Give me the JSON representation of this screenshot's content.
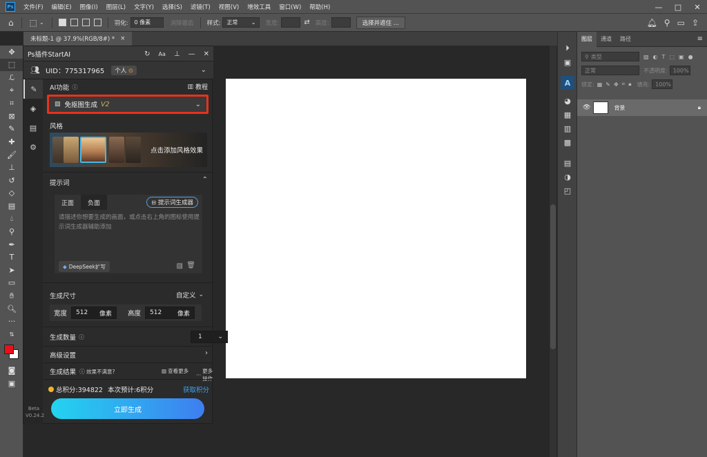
{
  "app": {
    "logo": "Ps"
  },
  "menubar": {
    "items": [
      "文件(F)",
      "编辑(E)",
      "图像(I)",
      "图层(L)",
      "文字(Y)",
      "选择(S)",
      "滤镜(T)",
      "视图(V)",
      "增效工具",
      "窗口(W)",
      "帮助(H)"
    ],
    "window_controls": [
      "—",
      "□",
      "✕"
    ]
  },
  "options_bar": {
    "feather_label": "羽化:",
    "feather_value": "0 像素",
    "antialias_label": "消除锯齿",
    "style_label": "样式:",
    "style_value": "正常",
    "width_label": "宽度:",
    "height_label": "高度:",
    "select_mask_button": "选择并遮住 ..."
  },
  "document": {
    "tab_title": "未标题-1 @ 37.9%(RGB/8#) *",
    "close": "×"
  },
  "plugin": {
    "title": "Ps插件StartAI",
    "uid": "UID：775317965",
    "account_type": "个人",
    "ai_function_label": "AI功能",
    "tutorial_label": "教程",
    "function_value": "免抠图生成",
    "function_version": "V2",
    "style_label": "风格",
    "style_add_label": "点击添加风格效果",
    "prompt_label": "提示词",
    "tab_positive": "正面",
    "tab_negative": "负面",
    "prompt_generator": "提示词生成器",
    "prompt_placeholder": "请描述你想要生成的画面，或点击右上角的图标使用提示词生成器辅助添加",
    "deepseek_label": "DeepSeek扩写",
    "size_label": "生成尺寸",
    "size_mode": "自定义",
    "width_label": "宽度",
    "width_value": "512",
    "width_unit": "像素",
    "height_label": "高度",
    "height_value": "512",
    "height_unit": "像素",
    "count_label": "生成数量",
    "count_value": "1",
    "advanced_label": "高级设置",
    "result_label": "生成结果",
    "unsatisfied_label": "效果不满意?",
    "view_more": "查看更多",
    "more_actions": "更多操作",
    "points_total": "总积分:394822",
    "points_cost": "本次预计:6积分",
    "get_points": "获取积分",
    "generate_button": "立即生成",
    "beta_label": "Beta",
    "version": "V0.24.2"
  },
  "layers_panel": {
    "tabs": [
      "图层",
      "通道",
      "路径"
    ],
    "filter_placeholder": "类型",
    "blend_mode": "正常",
    "opacity_label": "不透明度:",
    "opacity_value": "100%",
    "lock_label": "锁定:",
    "fill_label": "填充:",
    "fill_value": "100%",
    "layer_name": "背景"
  },
  "colors": {
    "foreground": "#e8101a",
    "background": "#ffffff",
    "highlight": "#e8321e",
    "accent": "#31a8ff"
  }
}
